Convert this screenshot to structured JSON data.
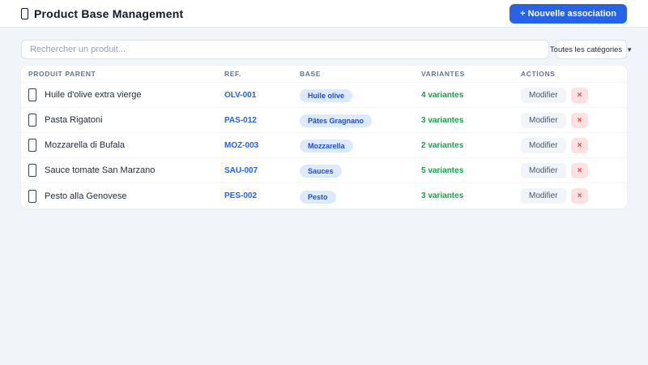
{
  "header": {
    "title": "Product Base Management",
    "new_association_label": "+ Nouvelle association"
  },
  "filters": {
    "search_placeholder": "Rechercher un produit...",
    "category_selected": "Toutes les catégories",
    "chevron": "▼"
  },
  "table": {
    "columns": {
      "product": "PRODUIT PARENT",
      "ref": "REF.",
      "base": "BASE",
      "variants": "VARIANTES",
      "actions": "ACTIONS"
    },
    "rows": [
      {
        "name": "Huile d'olive extra vierge",
        "ref": "OLV-001",
        "base": "Huile olive",
        "variants": "4 variantes"
      },
      {
        "name": "Pasta Rigatoni",
        "ref": "PAS-012",
        "base": "Pâtes Gragnano",
        "variants": "3 variantes"
      },
      {
        "name": "Mozzarella di Bufala",
        "ref": "MOZ-003",
        "base": "Mozzarella",
        "variants": "2 variantes"
      },
      {
        "name": "Sauce tomate San Marzano",
        "ref": "SAU-007",
        "base": "Sauces",
        "variants": "5 variantes"
      },
      {
        "name": "Pesto alla Genovese",
        "ref": "PES-002",
        "base": "Pesto",
        "variants": "3 variantes"
      }
    ],
    "actions": {
      "modify_label": "Modifier",
      "delete_label": "×"
    }
  },
  "colors": {
    "accent_blue": "#2563eb",
    "badge_bg": "#dbeafe",
    "badge_text": "#1d4ed8",
    "variants_green": "#16a34a",
    "delete_red": "#ef4444",
    "delete_bg": "#fee2e2"
  }
}
